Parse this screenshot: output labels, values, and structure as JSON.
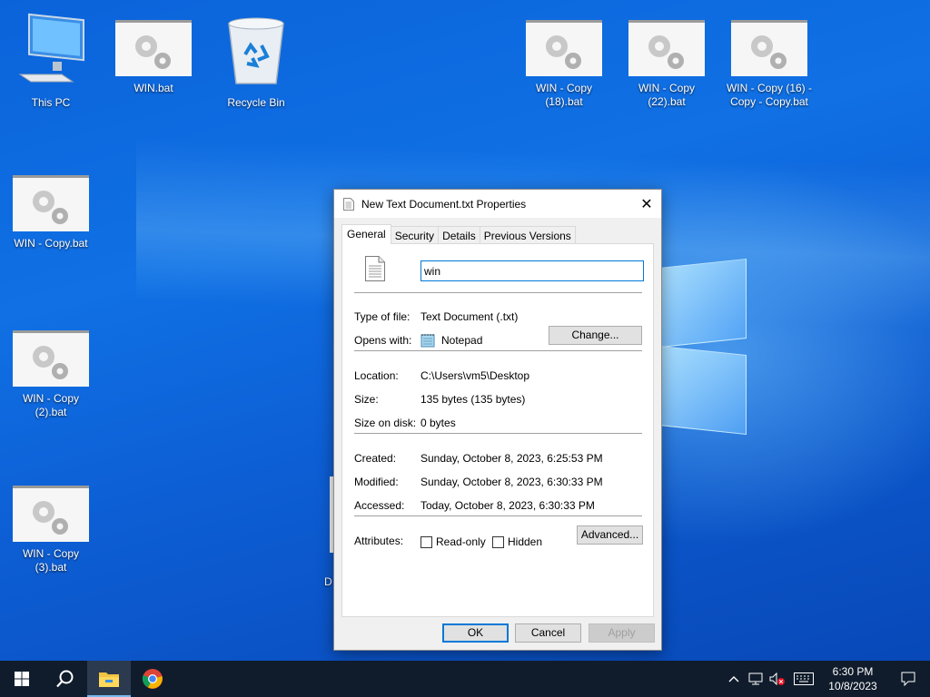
{
  "desktop": {
    "icons": [
      {
        "label": "This PC",
        "icon": "computer-icon"
      },
      {
        "label": "WIN.bat",
        "icon": "batch-file-icon"
      },
      {
        "label": "Recycle Bin",
        "icon": "recycle-bin-icon"
      },
      {
        "label": "WIN - Copy (18).bat",
        "icon": "batch-file-icon"
      },
      {
        "label": "WIN - Copy (22).bat",
        "icon": "batch-file-icon"
      },
      {
        "label": "WIN - Copy (16) - Copy - Copy.bat",
        "icon": "batch-file-icon"
      },
      {
        "label": "WIN - Copy.bat",
        "icon": "batch-file-icon"
      },
      {
        "label": "WIN - Copy (2).bat",
        "icon": "batch-file-icon"
      },
      {
        "label": "WIN - Copy (3).bat",
        "icon": "batch-file-icon"
      }
    ],
    "partial_label": "D"
  },
  "dialog": {
    "title": "New Text Document.txt Properties",
    "tabs": [
      "General",
      "Security",
      "Details",
      "Previous Versions"
    ],
    "active_tab": "General",
    "file_name": "win",
    "type_label": "Type of file:",
    "type_value": "Text Document (.txt)",
    "opens_label": "Opens with:",
    "opens_value": "Notepad",
    "change_button": "Change...",
    "location_label": "Location:",
    "location_value": "C:\\Users\\vm5\\Desktop",
    "size_label": "Size:",
    "size_value": "135 bytes (135 bytes)",
    "size_disk_label": "Size on disk:",
    "size_disk_value": "0 bytes",
    "created_label": "Created:",
    "created_value": "Sunday, October 8, 2023, 6:25:53 PM",
    "modified_label": "Modified:",
    "modified_value": "Sunday, October 8, 2023, 6:30:33 PM",
    "accessed_label": "Accessed:",
    "accessed_value": "Today, October 8, 2023, 6:30:33 PM",
    "attributes_label": "Attributes:",
    "readonly_label": "Read-only",
    "hidden_label": "Hidden",
    "advanced_button": "Advanced...",
    "ok_button": "OK",
    "cancel_button": "Cancel",
    "apply_button": "Apply"
  },
  "taskbar": {
    "time": "6:30 PM",
    "date": "10/8/2023"
  },
  "colors": {
    "accent": "#0078d7",
    "taskbar": "#101c2c",
    "desktop": "#0a5fd6"
  }
}
